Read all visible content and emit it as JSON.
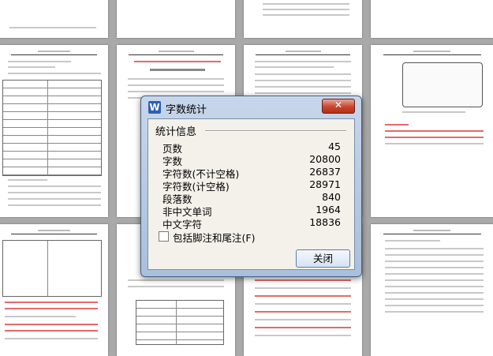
{
  "dialog": {
    "app_icon": "W",
    "title": "字数统计",
    "close_glyph": "✕",
    "section_title": "统计信息",
    "stats": [
      {
        "label": "页数",
        "value": "45"
      },
      {
        "label": "字数",
        "value": "20800"
      },
      {
        "label": "字符数(不计空格)",
        "value": "26837"
      },
      {
        "label": "字符数(计空格)",
        "value": "28971"
      },
      {
        "label": "段落数",
        "value": "840"
      },
      {
        "label": "非中文单词",
        "value": "1964"
      },
      {
        "label": "中文字符",
        "value": "18836"
      }
    ],
    "checkbox_label": "包括脚注和尾注(F)",
    "checkbox_checked": false,
    "ok_label": "关闭"
  },
  "colors": {
    "workspace": "#a9a9a9",
    "close_button": "#c8452e",
    "red_text": "#e26a6a"
  }
}
